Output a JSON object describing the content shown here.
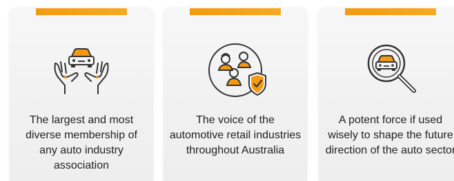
{
  "theme": {
    "accent": "#f39a14",
    "card_bg": "#f2f2f2",
    "text_color": "#222222"
  },
  "cards": [
    {
      "icon": "hands-holding-car-icon",
      "text": "The largest and most diverse membership of any auto industry association"
    },
    {
      "icon": "people-shield-icon",
      "text": "The voice of the automotive retail industries throughout Australia"
    },
    {
      "icon": "car-magnifier-icon",
      "text": "A potent force if used wisely to shape the future direction of the auto sector"
    }
  ]
}
